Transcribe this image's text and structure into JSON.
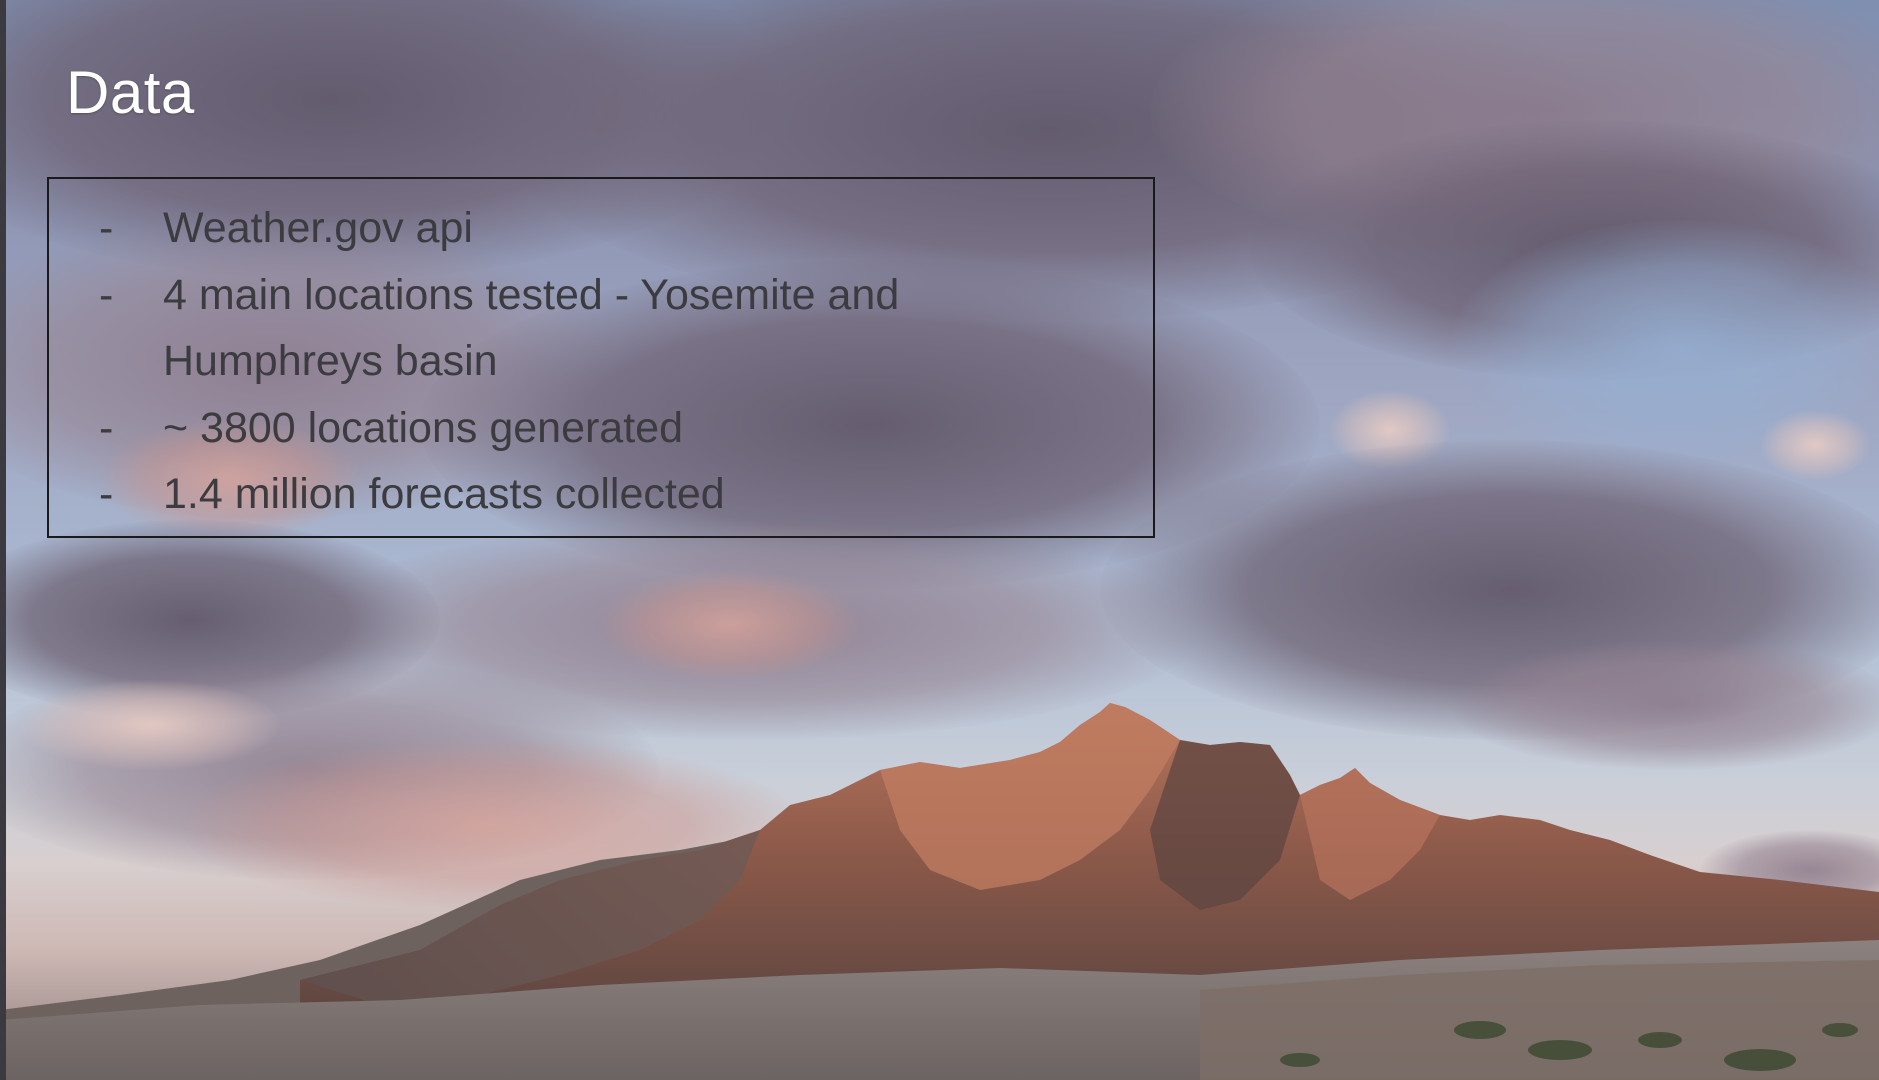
{
  "slide": {
    "title": "Data",
    "bullets": [
      "Weather.gov api",
      "4 main locations tested - Yosemite and Humphreys basin",
      "~ 3800 locations generated",
      "1.4 million forecasts collected"
    ],
    "bullet_marker": "-",
    "background_image": "mountain-sunset-photo",
    "colors": {
      "title": "#ffffff",
      "bullet_text": "#3b3b40",
      "box_border": "#1a1a1a"
    }
  }
}
